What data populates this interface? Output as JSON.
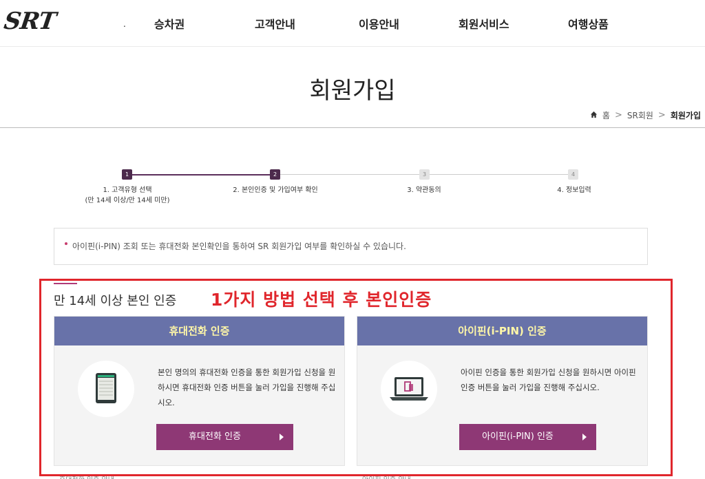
{
  "header": {
    "logo": "SRT",
    "nav_dot": ".",
    "nav": [
      "승차권",
      "고객안내",
      "이용안내",
      "회원서비스",
      "여행상품"
    ]
  },
  "page": {
    "title": "회원가입",
    "breadcrumb": {
      "home": "홈",
      "sep": ">",
      "parent": "SR회원",
      "current": "회원가입"
    }
  },
  "steps": [
    {
      "num": "1",
      "label": "1. 고객유형 선택",
      "sub": "(만 14세 이상/만 14세 미만)",
      "active": true
    },
    {
      "num": "2",
      "label": "2. 본인인증 및 가입여부 확인",
      "sub": "",
      "active": true
    },
    {
      "num": "3",
      "label": "3. 약관동의",
      "sub": "",
      "active": false
    },
    {
      "num": "4",
      "label": "4. 정보입력",
      "sub": "",
      "active": false
    }
  ],
  "info": {
    "text": "아이핀(i-PIN) 조회 또는 휴대전화 본인확인을 통하여 SR 회원가입 여부를 확인하실 수 있습니다."
  },
  "section": {
    "title": "만 14세 이상 본인 인증",
    "annotation": "1가지 방법 선택 후 본인인증"
  },
  "cards": {
    "phone": {
      "title": "휴대전화 인증",
      "desc": "본인 명의의 휴대전화 인증을 통한 회원가입 신청을 원하시면 휴대전화 인증 버튼을 눌러 가입을 진행해 주십시오.",
      "button": "휴대전화 인증",
      "below": "휴대전화 인증 안내"
    },
    "ipin": {
      "title": "아이핀(i-PIN) 인증",
      "desc": "아이핀 인증을 통한 회원가입 신청을 원하시면 아이핀 인증 버튼을 눌러 가입을 진행해 주십시오.",
      "button": "아이핀(i-PIN) 인증",
      "below": "아이핀 인증 안내"
    }
  },
  "colors": {
    "accent": "#8e3875",
    "card_header": "#6872a9",
    "card_header_text": "#fff7a8",
    "annotation": "#e0262c"
  }
}
